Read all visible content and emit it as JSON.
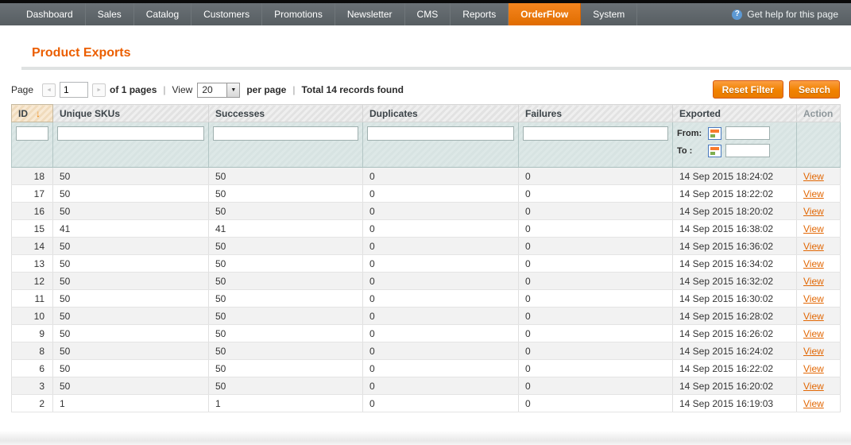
{
  "nav": {
    "items": [
      "Dashboard",
      "Sales",
      "Catalog",
      "Customers",
      "Promotions",
      "Newsletter",
      "CMS",
      "Reports",
      "OrderFlow",
      "System"
    ],
    "active_item": "OrderFlow",
    "help_label": "Get help for this page"
  },
  "icons": {
    "help": "?",
    "prev_arrow": "◄",
    "next_arrow": "►",
    "dropdown_arrow": "▼",
    "sort_desc_arrow": "↓"
  },
  "page": {
    "title": "Product Exports"
  },
  "toolbar": {
    "page_label": "Page",
    "page_value": "1",
    "pages_text": "of 1 pages",
    "separator": "|",
    "view_label": "View",
    "view_value": "20",
    "per_page_text": "per page",
    "total_text": "Total 14 records found",
    "reset_button": "Reset Filter",
    "search_button": "Search"
  },
  "grid": {
    "headers": {
      "id": "ID",
      "skus": "Unique SKUs",
      "successes": "Successes",
      "duplicates": "Duplicates",
      "failures": "Failures",
      "exported": "Exported",
      "action": "Action"
    },
    "sort": {
      "column": "ID",
      "direction": "desc"
    },
    "filter": {
      "from_label": "From:",
      "to_label": "To :"
    },
    "rows": [
      {
        "id": "18",
        "skus": "50",
        "successes": "50",
        "duplicates": "0",
        "failures": "0",
        "exported": "14 Sep 2015 18:24:02",
        "action": "View"
      },
      {
        "id": "17",
        "skus": "50",
        "successes": "50",
        "duplicates": "0",
        "failures": "0",
        "exported": "14 Sep 2015 18:22:02",
        "action": "View"
      },
      {
        "id": "16",
        "skus": "50",
        "successes": "50",
        "duplicates": "0",
        "failures": "0",
        "exported": "14 Sep 2015 18:20:02",
        "action": "View"
      },
      {
        "id": "15",
        "skus": "41",
        "successes": "41",
        "duplicates": "0",
        "failures": "0",
        "exported": "14 Sep 2015 16:38:02",
        "action": "View"
      },
      {
        "id": "14",
        "skus": "50",
        "successes": "50",
        "duplicates": "0",
        "failures": "0",
        "exported": "14 Sep 2015 16:36:02",
        "action": "View"
      },
      {
        "id": "13",
        "skus": "50",
        "successes": "50",
        "duplicates": "0",
        "failures": "0",
        "exported": "14 Sep 2015 16:34:02",
        "action": "View"
      },
      {
        "id": "12",
        "skus": "50",
        "successes": "50",
        "duplicates": "0",
        "failures": "0",
        "exported": "14 Sep 2015 16:32:02",
        "action": "View"
      },
      {
        "id": "11",
        "skus": "50",
        "successes": "50",
        "duplicates": "0",
        "failures": "0",
        "exported": "14 Sep 2015 16:30:02",
        "action": "View"
      },
      {
        "id": "10",
        "skus": "50",
        "successes": "50",
        "duplicates": "0",
        "failures": "0",
        "exported": "14 Sep 2015 16:28:02",
        "action": "View"
      },
      {
        "id": "9",
        "skus": "50",
        "successes": "50",
        "duplicates": "0",
        "failures": "0",
        "exported": "14 Sep 2015 16:26:02",
        "action": "View"
      },
      {
        "id": "8",
        "skus": "50",
        "successes": "50",
        "duplicates": "0",
        "failures": "0",
        "exported": "14 Sep 2015 16:24:02",
        "action": "View"
      },
      {
        "id": "6",
        "skus": "50",
        "successes": "50",
        "duplicates": "0",
        "failures": "0",
        "exported": "14 Sep 2015 16:22:02",
        "action": "View"
      },
      {
        "id": "3",
        "skus": "50",
        "successes": "50",
        "duplicates": "0",
        "failures": "0",
        "exported": "14 Sep 2015 16:20:02",
        "action": "View"
      },
      {
        "id": "2",
        "skus": "1",
        "successes": "1",
        "duplicates": "0",
        "failures": "0",
        "exported": "14 Sep 2015 16:19:03",
        "action": "View"
      }
    ]
  },
  "colors": {
    "accent_orange": "#eb5e00",
    "nav_bg": "#5d6468",
    "nav_active_orange": "#e87400",
    "button_orange": "#f18200",
    "link_orange": "#e26703",
    "filter_row_bg": "#dbe6e5"
  }
}
